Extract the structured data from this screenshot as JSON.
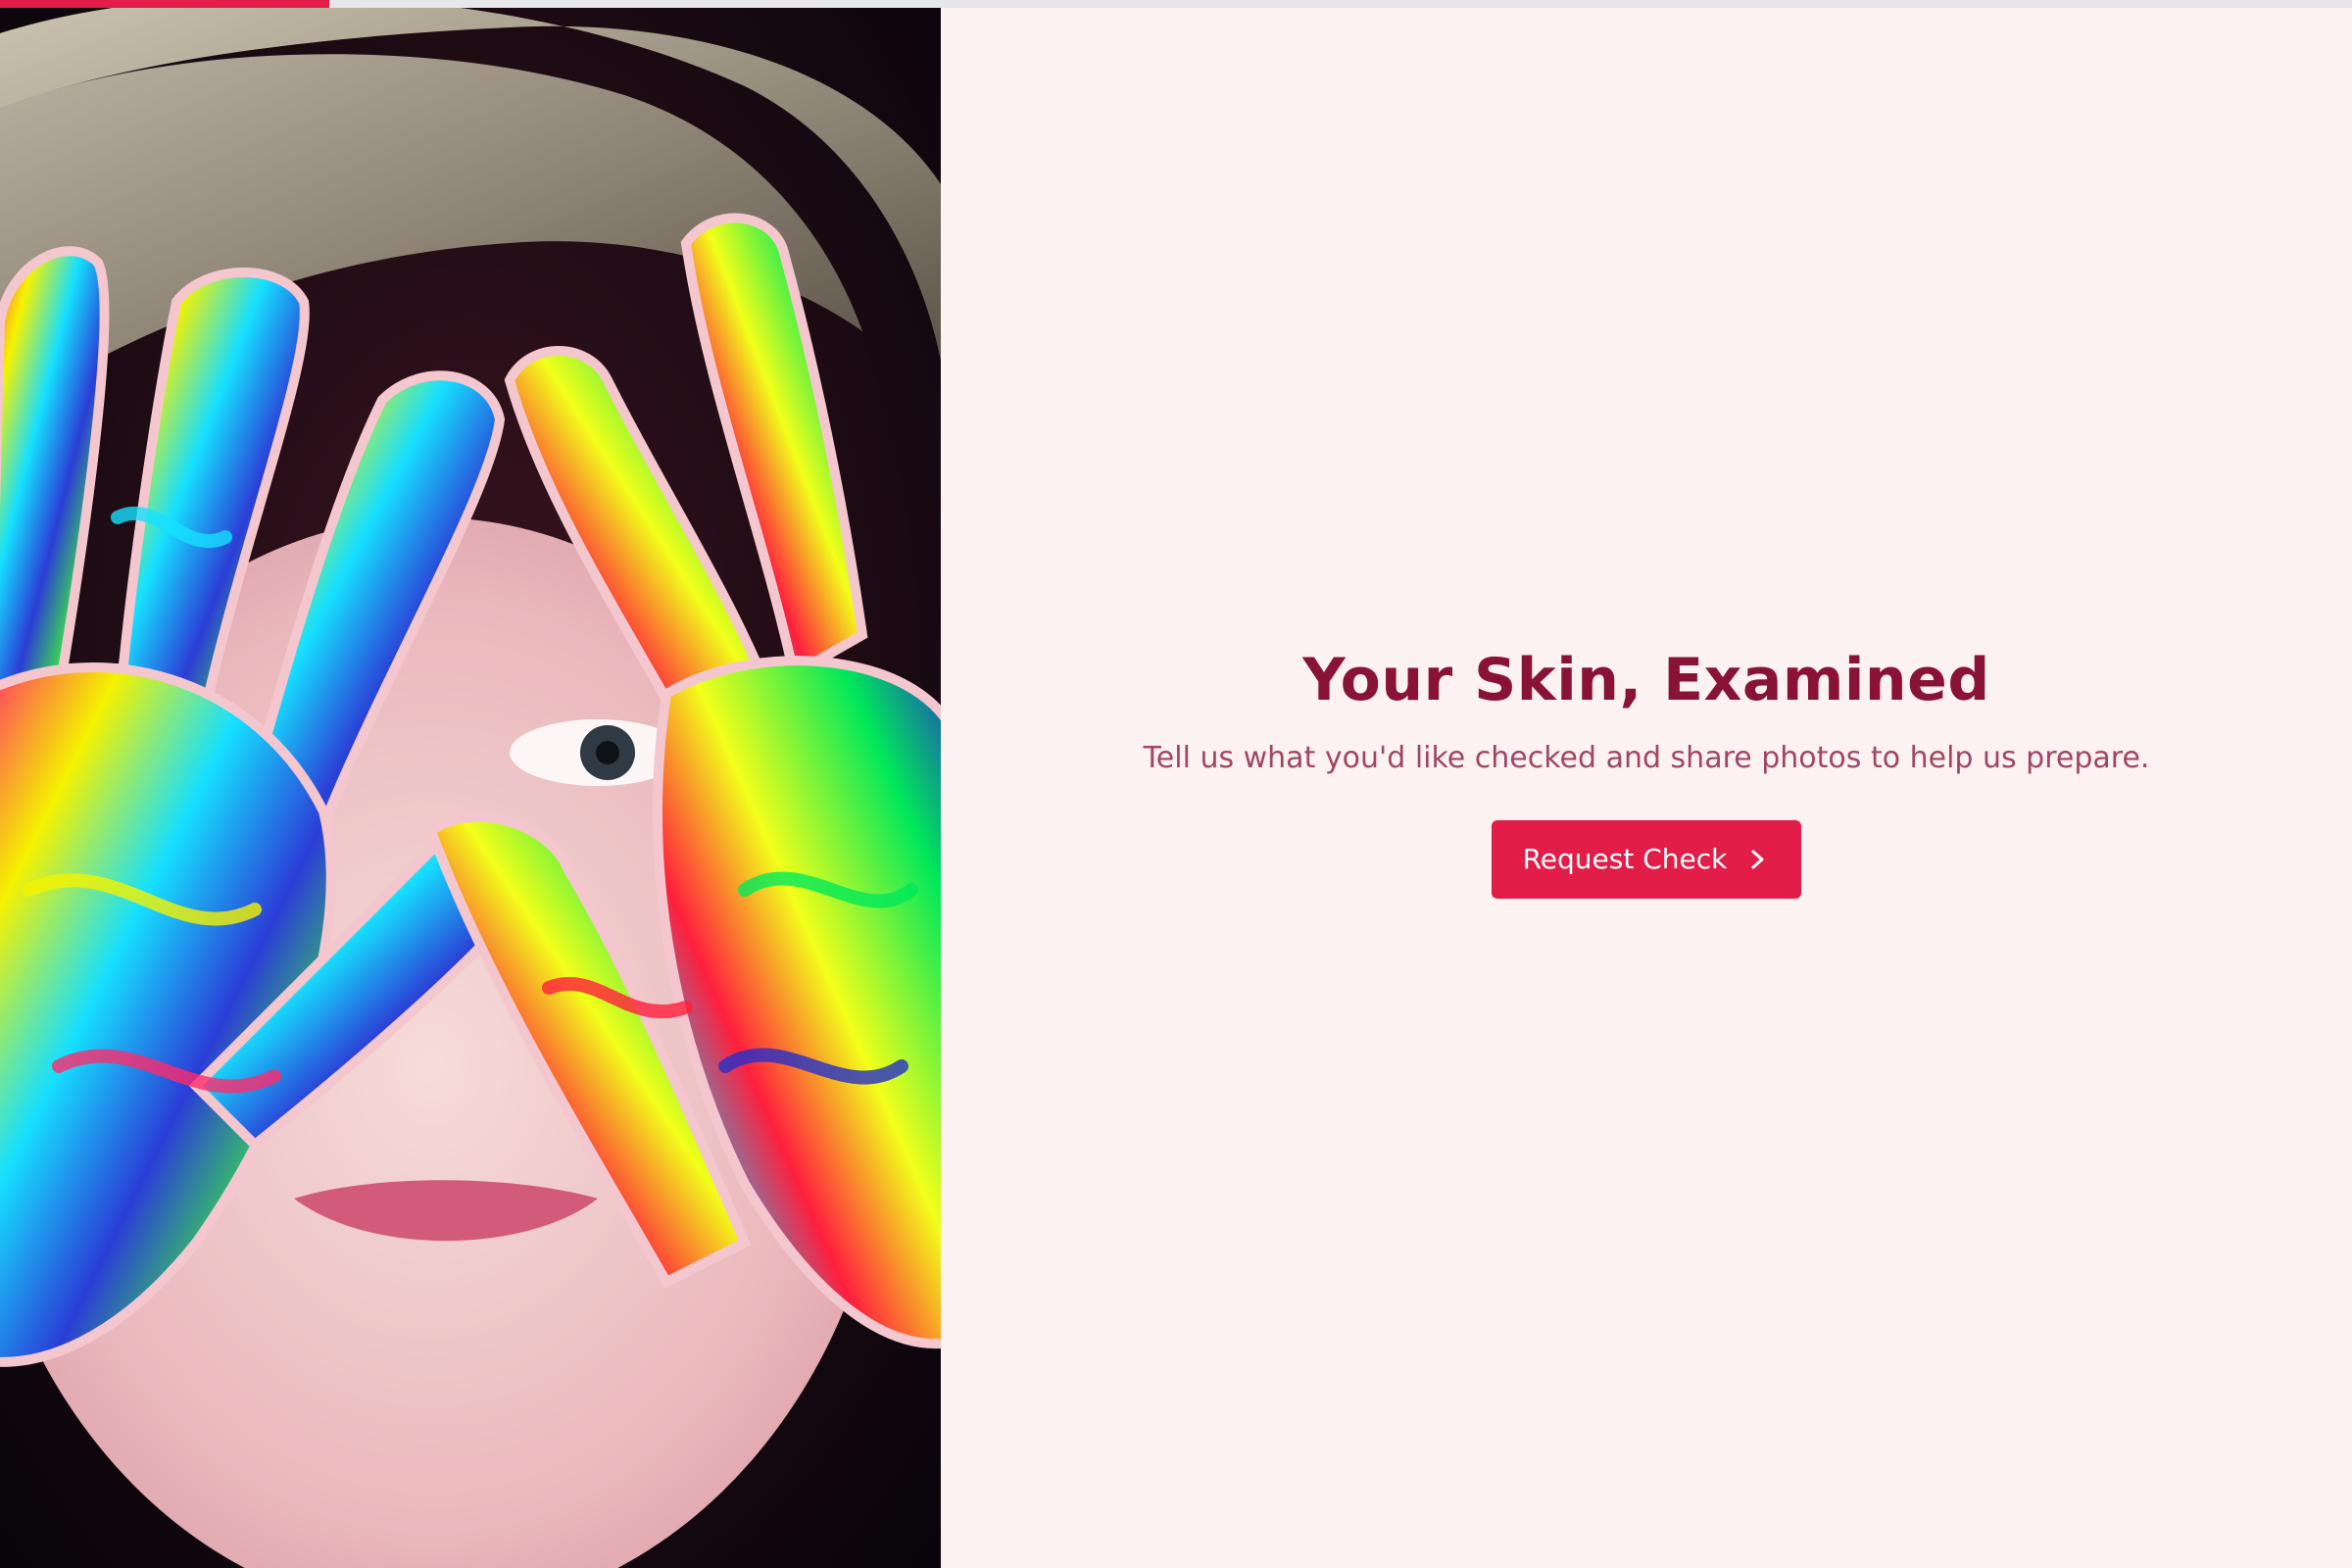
{
  "progress": {
    "fraction": 0.14,
    "fill_color": "#e11d48",
    "track_color": "#e5e7eb"
  },
  "hero": {
    "image": "child-with-paint-covered-hands-over-face"
  },
  "main": {
    "title": "Your Skin, Examined",
    "subtitle": "Tell us what you'd like checked and share photos to help us prepare.",
    "cta_label": "Request Check",
    "cta_icon": "chevron-right-icon"
  },
  "colors": {
    "background": "#fdf2f2",
    "title": "#881337",
    "subtitle": "#9f4667",
    "accent": "#e11d48"
  }
}
